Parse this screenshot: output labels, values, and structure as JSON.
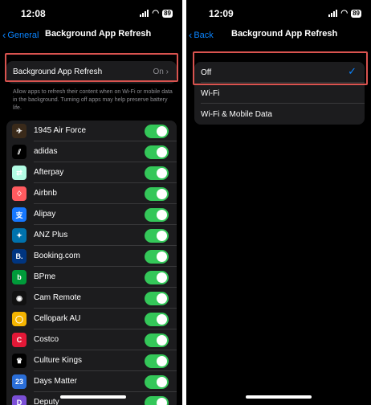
{
  "left": {
    "time": "12:08",
    "battery": "89",
    "nav": {
      "back_label": "General",
      "title": "Background App Refresh"
    },
    "setting": {
      "label": "Background App Refresh",
      "value": "On"
    },
    "description": "Allow apps to refresh their content when on Wi-Fi or mobile data in the background. Turning off apps may help preserve battery life.",
    "apps": [
      {
        "name": "1945 Air Force",
        "icon": "1945-air-force-icon",
        "glyph": "✈",
        "color": "#3a2a1a",
        "on": true
      },
      {
        "name": "adidas",
        "icon": "adidas-icon",
        "glyph": "⫽",
        "color": "#000000",
        "on": true
      },
      {
        "name": "Afterpay",
        "icon": "afterpay-icon",
        "glyph": "⇄",
        "color": "#b2fce4",
        "on": true
      },
      {
        "name": "Airbnb",
        "icon": "airbnb-icon",
        "glyph": "♢",
        "color": "#ff5a5f",
        "on": true
      },
      {
        "name": "Alipay",
        "icon": "alipay-icon",
        "glyph": "支",
        "color": "#1677ff",
        "on": true
      },
      {
        "name": "ANZ Plus",
        "icon": "anz-plus-icon",
        "glyph": "✦",
        "color": "#0072ac",
        "on": true
      },
      {
        "name": "Booking.com",
        "icon": "booking-icon",
        "glyph": "B.",
        "color": "#003580",
        "on": true
      },
      {
        "name": "BPme",
        "icon": "bpme-icon",
        "glyph": "b",
        "color": "#009b3a",
        "on": true
      },
      {
        "name": "Cam Remote",
        "icon": "cam-remote-icon",
        "glyph": "◉",
        "color": "#111111",
        "on": true
      },
      {
        "name": "Cellopark AU",
        "icon": "cellopark-icon",
        "glyph": "◯",
        "color": "#f4b400",
        "on": true
      },
      {
        "name": "Costco",
        "icon": "costco-icon",
        "glyph": "C",
        "color": "#e31837",
        "on": true
      },
      {
        "name": "Culture Kings",
        "icon": "culture-kings-icon",
        "glyph": "♛",
        "color": "#000000",
        "on": true
      },
      {
        "name": "Days Matter",
        "icon": "days-matter-icon",
        "glyph": "23",
        "color": "#2a6ed8",
        "on": true
      },
      {
        "name": "Deputy",
        "icon": "deputy-icon",
        "glyph": "D",
        "color": "#7b4fd6",
        "on": true
      }
    ]
  },
  "right": {
    "time": "12:09",
    "battery": "89",
    "nav": {
      "back_label": "Back",
      "title": "Background App Refresh"
    },
    "options": [
      {
        "label": "Off",
        "selected": true
      },
      {
        "label": "Wi-Fi",
        "selected": false
      },
      {
        "label": "Wi-Fi & Mobile Data",
        "selected": false
      }
    ]
  },
  "colors": {
    "accent": "#0a84ff",
    "toggle_on": "#34c759",
    "highlight": "#d9534f",
    "cell": "#1c1c1e"
  }
}
